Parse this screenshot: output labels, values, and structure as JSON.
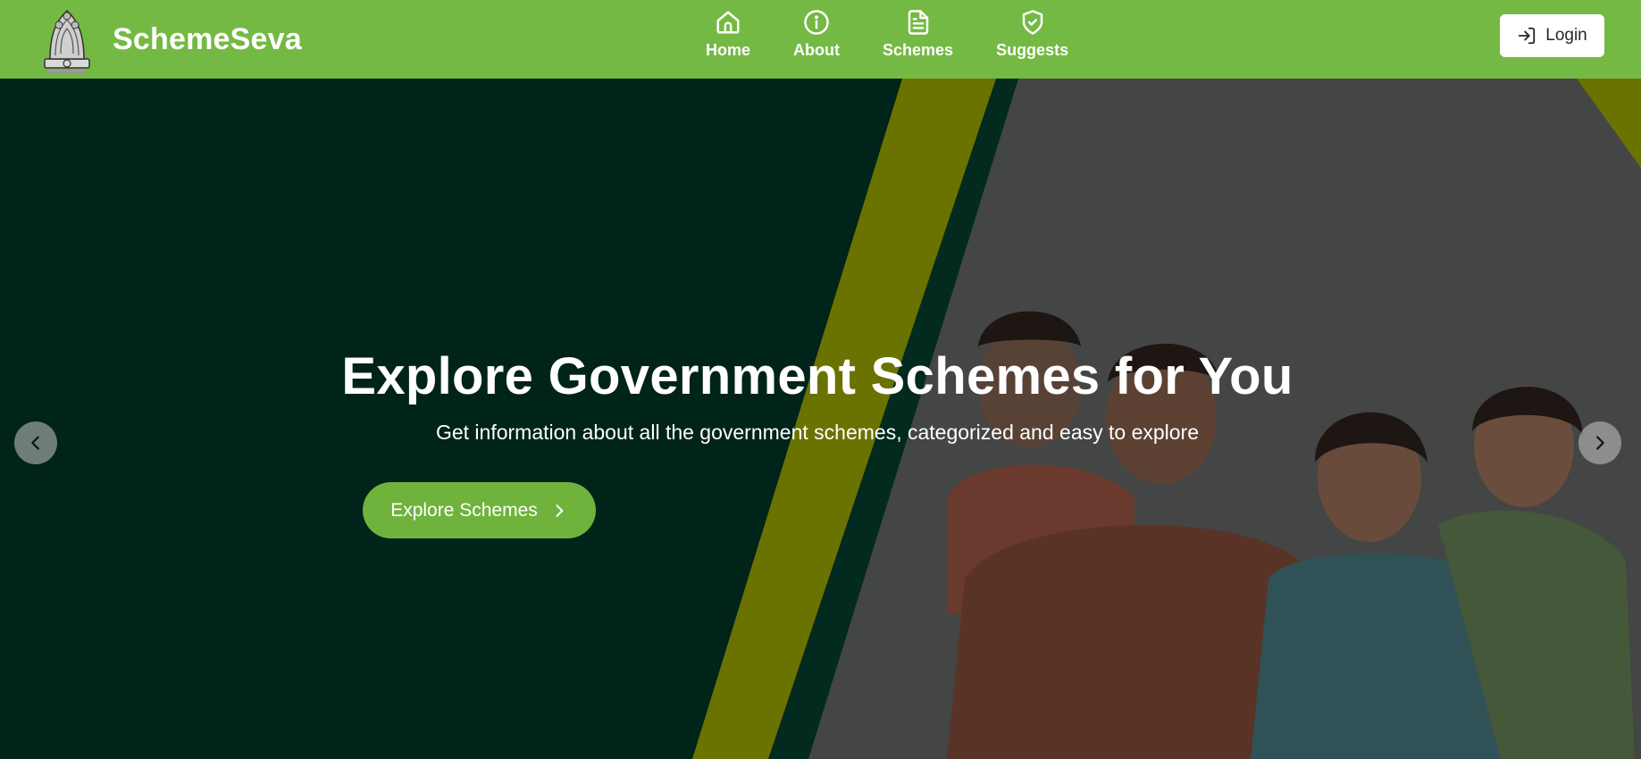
{
  "brand": {
    "name": "SchemeSeva",
    "logo_icon": "national-emblem-icon"
  },
  "nav": {
    "items": [
      {
        "label": "Home",
        "icon": "home-icon"
      },
      {
        "label": "About",
        "icon": "info-icon"
      },
      {
        "label": "Schemes",
        "icon": "document-icon"
      },
      {
        "label": "Suggests",
        "icon": "shield-check-icon"
      }
    ],
    "login_label": "Login"
  },
  "hero": {
    "title": "Explore Government Schemes for You",
    "subtitle": "Get information about all the government schemes, categorized and easy to explore",
    "cta_label": "Explore Schemes"
  },
  "colors": {
    "navbar": "#74b943",
    "hero_dark": "#00231a",
    "stripe": "#6a7300",
    "cta": "#6fb33d"
  }
}
